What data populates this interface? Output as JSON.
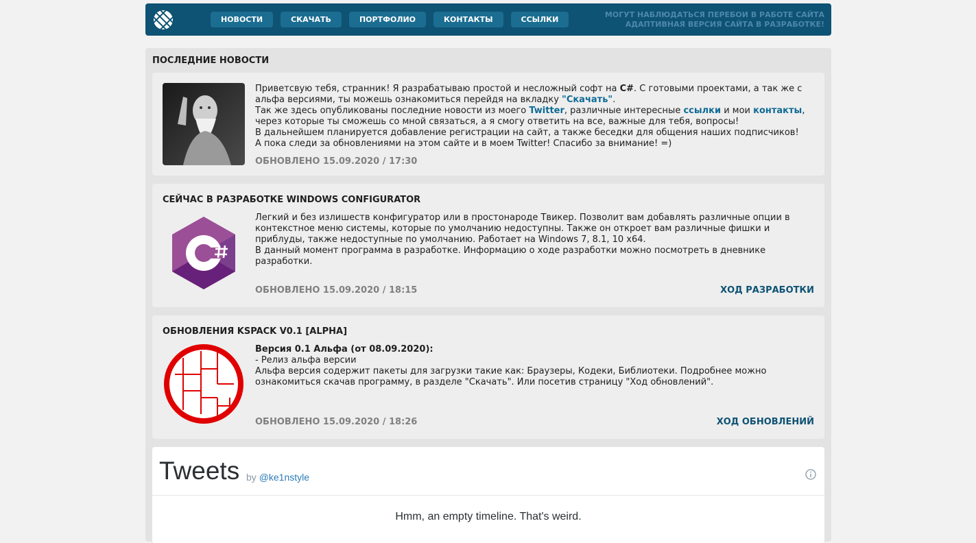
{
  "header": {
    "nav": [
      "НОВОСТИ",
      "СКАЧАТЬ",
      "ПОРТФОЛИО",
      "КОНТАКТЫ",
      "ССЫЛКИ"
    ],
    "notice_line1": "МОГУТ НАБЛЮДАТЬСЯ ПЕРЕБОИ В РАБОТЕ САЙТА",
    "notice_line2": "АДАПТИВНАЯ ВЕРСИЯ САЙТА В РАЗРАБОТКЕ!",
    "logo_icon": "striped-globe-logo"
  },
  "section_title": "ПОСЛЕДНИЕ НОВОСТИ",
  "posts": [
    {
      "image": "old-man-photo",
      "p1_a": "Приветсвую тебя, странник! Я разрабатываю простой и несложный софт на ",
      "p1_b": "C#",
      "p1_c": ". С готовыми проектами, а так же с альфа версиями, ты можешь ознакомиться перейдя на вкладку ",
      "p1_link": "\"Скачать\"",
      "p1_d": ".",
      "p2_a": "Так же здесь опубликованы последние новости из моего ",
      "p2_twitter": "Twitter",
      "p2_b": ", различные интересные ",
      "p2_links": "ссылки",
      "p2_c": " и мои ",
      "p2_contacts": "контакты",
      "p2_d": ", через которые ты сможешь со мной связаться, а я смогу ответить на все, важные для тебя, вопросы!",
      "p3": "В дальнейшем планируется добавление регистрации на сайт, а также беседки для общения наших подписчиков!",
      "p4": "А пока следи за обновлениями на этом сайте и в моем Twitter! Спасибо за внимание! =)",
      "date": "ОБНОВЛЕНО 15.09.2020 / 17:30"
    },
    {
      "title": "СЕЙЧАС В РАЗРАБОТКЕ WINDOWS CONFIGURATOR",
      "image": "csharp-logo",
      "text1": "Легкий и без излишеств конфигуратор или в простонароде Твикер. Позволит вам добавлять различные опции в контекстное меню системы, которые по умолчанию недоступны. Также он откроет вам различные фишки и приблуды, также недоступные по умолчанию. Работает на Windows 7, 8.1, 10 x64.",
      "text2": "В данный момент программа в разработке. Информацию о ходе разработки можно посмотреть в дневнике разработки.",
      "date": "ОБНОВЛЕНО 15.09.2020 / 18:15",
      "link": "ХОД РАЗРАБОТКИ"
    },
    {
      "title": "ОБНОВЛЕНИЯ KSPACK V0.1 [ALPHA]",
      "image": "kspack-red-logo",
      "heading": "Версия 0.1 Альфа (от 08.09.2020):",
      "line1": "- Релиз альфа версии",
      "line2": "Альфа версия содержит пакеты для загрузки такие как: Браузеры, Кодеки, Библиотеки. Подробнее можно ознакомиться скачав программу, в разделе \"Скачать\". Или посетив страницу \"Ход обновлений\".",
      "date": "ОБНОВЛЕНО 15.09.2020 / 18:26",
      "link": "ХОД ОБНОВЛЕНИЙ"
    }
  ],
  "tweets": {
    "title": "Tweets",
    "by": "by",
    "handle": "@ke1nstyle",
    "empty": "Hmm, an empty timeline. That's weird."
  }
}
